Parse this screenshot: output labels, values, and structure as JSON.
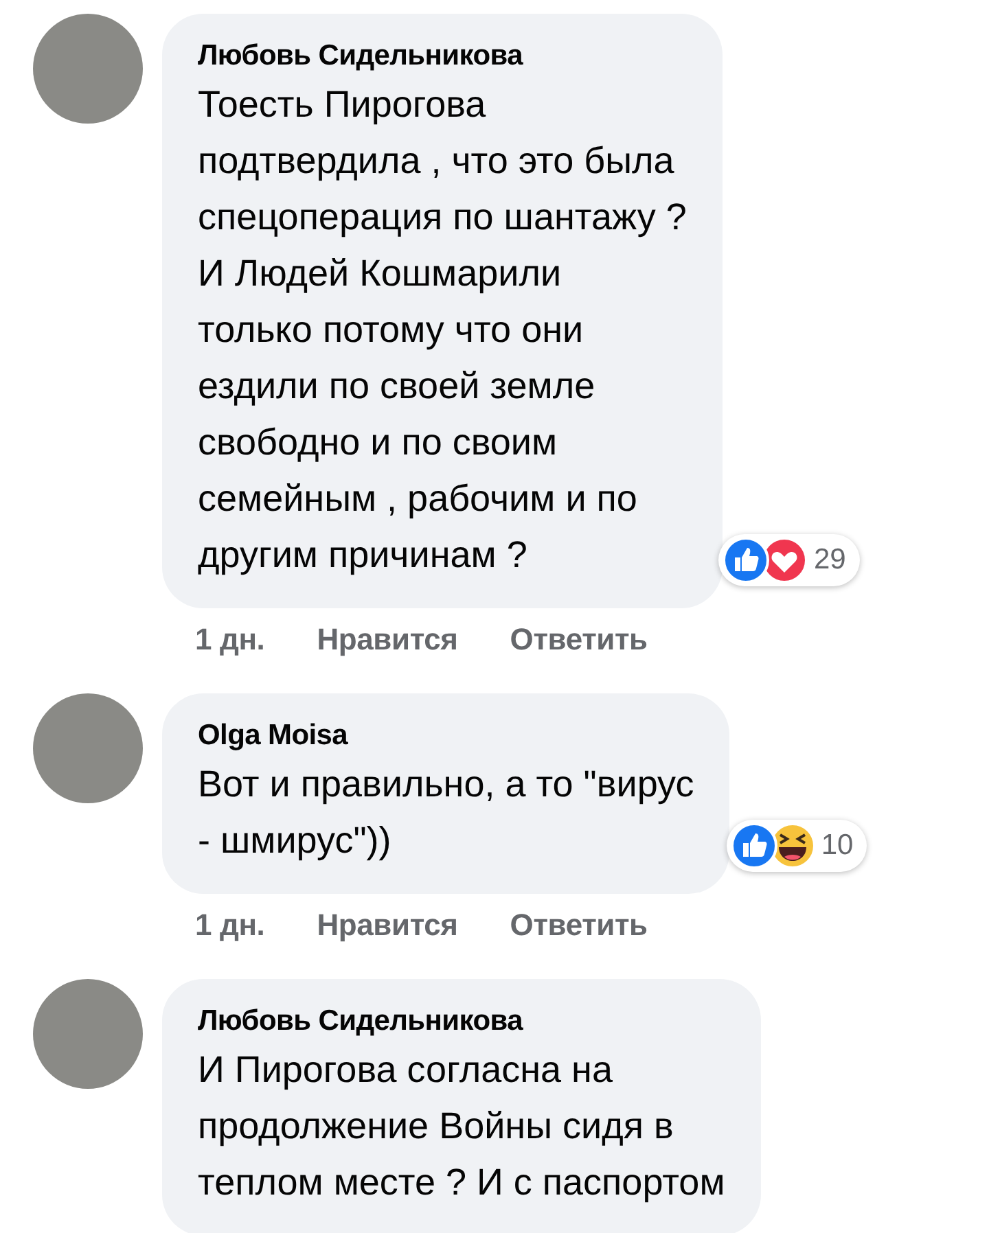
{
  "comments": [
    {
      "author": "Любовь Сидельникова",
      "text": "Тоесть Пирогова\nподтвердила , что это была\nспецоперация по шантажу ?\nИ Людей Кошмарили\nтолько потому что они\nездили по своей земле\nсвободно и по своим\nсемейным , рабочим и по\nдругим причинам ?",
      "reactions": [
        {
          "kind": "like"
        },
        {
          "kind": "love"
        }
      ],
      "reaction_count": "29",
      "time": "1 дн.",
      "actions": [
        "Нравится",
        "Ответить"
      ]
    },
    {
      "author": "Olga Moisa",
      "text": "Вот и правильно, а то \"вирус\n- шмирус\"))",
      "reactions": [
        {
          "kind": "like"
        },
        {
          "kind": "haha"
        }
      ],
      "reaction_count": "10",
      "time": "1 дн.",
      "actions": [
        "Нравится",
        "Ответить"
      ]
    },
    {
      "author": "Любовь Сидельникова",
      "text": "И Пирогова согласна на\nпродолжение Войны сидя в\nтеплом месте ?  И с паспортом"
    }
  ]
}
